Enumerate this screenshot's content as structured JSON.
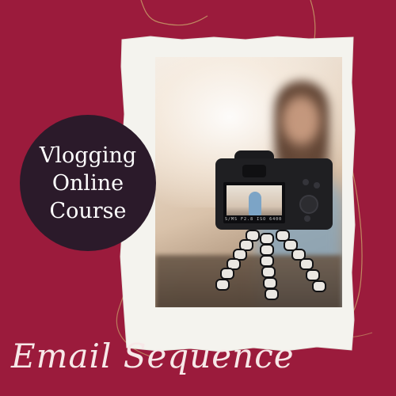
{
  "title_circle": {
    "line1": "Vlogging",
    "line2": "Online",
    "line3": "Course"
  },
  "footer": {
    "script_title": "Email Sequence"
  },
  "camera": {
    "screen_text": "S/MS   F2.8   ISO  6400"
  },
  "colors": {
    "background": "#9b1b3c",
    "circle": "#2b1a2a",
    "paper": "#f4f3ee",
    "wire": "#c9a46a"
  },
  "icons": [
    "camera-icon",
    "tripod-icon"
  ]
}
